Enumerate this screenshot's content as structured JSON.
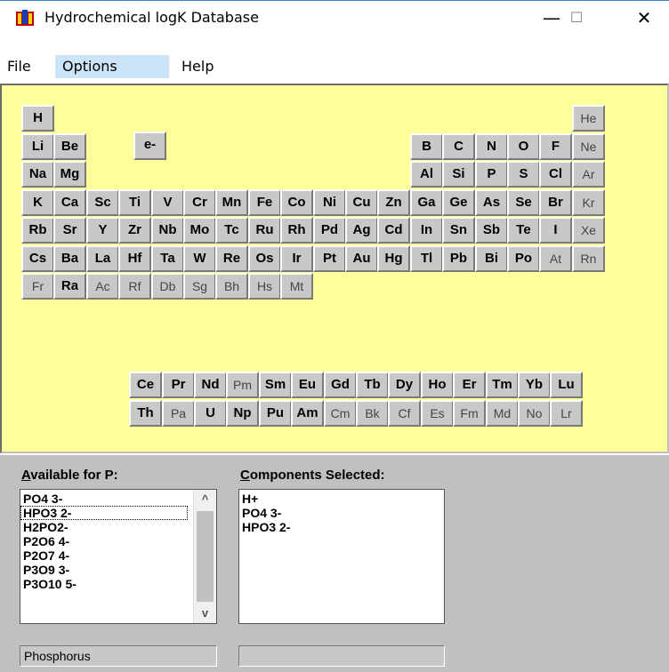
{
  "window": {
    "title": "Hydrochemical logK Database",
    "minimize": "—",
    "maximize": "☐",
    "close": "✕"
  },
  "menu": [
    "File",
    "Options",
    "Help"
  ],
  "electron_button": "e-",
  "table_rows": [
    [
      [
        "H",
        "b"
      ],
      null,
      null,
      null,
      null,
      null,
      null,
      null,
      null,
      null,
      null,
      null,
      null,
      null,
      null,
      null,
      null,
      [
        "He",
        "d"
      ]
    ],
    [
      [
        "Li",
        "b"
      ],
      [
        "Be",
        "b"
      ],
      null,
      null,
      null,
      null,
      null,
      null,
      null,
      null,
      null,
      null,
      [
        "B",
        "b"
      ],
      [
        "C",
        "b"
      ],
      [
        "N",
        "b"
      ],
      [
        "O",
        "b"
      ],
      [
        "F",
        "b"
      ],
      [
        "Ne",
        "d"
      ]
    ],
    [
      [
        "Na",
        "b"
      ],
      [
        "Mg",
        "b"
      ],
      null,
      null,
      null,
      null,
      null,
      null,
      null,
      null,
      null,
      null,
      [
        "Al",
        "b"
      ],
      [
        "Si",
        "b"
      ],
      [
        "P",
        "b"
      ],
      [
        "S",
        "b"
      ],
      [
        "Cl",
        "b"
      ],
      [
        "Ar",
        "d"
      ]
    ],
    [
      [
        "K",
        "b"
      ],
      [
        "Ca",
        "b"
      ],
      [
        "Sc",
        "b"
      ],
      [
        "Ti",
        "b"
      ],
      [
        "V",
        "b"
      ],
      [
        "Cr",
        "b"
      ],
      [
        "Mn",
        "b"
      ],
      [
        "Fe",
        "b"
      ],
      [
        "Co",
        "b"
      ],
      [
        "Ni",
        "b"
      ],
      [
        "Cu",
        "b"
      ],
      [
        "Zn",
        "b"
      ],
      [
        "Ga",
        "b"
      ],
      [
        "Ge",
        "b"
      ],
      [
        "As",
        "b"
      ],
      [
        "Se",
        "b"
      ],
      [
        "Br",
        "b"
      ],
      [
        "Kr",
        "d"
      ]
    ],
    [
      [
        "Rb",
        "b"
      ],
      [
        "Sr",
        "b"
      ],
      [
        "Y",
        "b"
      ],
      [
        "Zr",
        "b"
      ],
      [
        "Nb",
        "b"
      ],
      [
        "Mo",
        "b"
      ],
      [
        "Tc",
        "b"
      ],
      [
        "Ru",
        "b"
      ],
      [
        "Rh",
        "b"
      ],
      [
        "Pd",
        "b"
      ],
      [
        "Ag",
        "b"
      ],
      [
        "Cd",
        "b"
      ],
      [
        "In",
        "b"
      ],
      [
        "Sn",
        "b"
      ],
      [
        "Sb",
        "b"
      ],
      [
        "Te",
        "b"
      ],
      [
        "I",
        "b"
      ],
      [
        "Xe",
        "d"
      ]
    ],
    [
      [
        "Cs",
        "b"
      ],
      [
        "Ba",
        "b"
      ],
      [
        "La",
        "b"
      ],
      [
        "Hf",
        "b"
      ],
      [
        "Ta",
        "b"
      ],
      [
        "W",
        "b"
      ],
      [
        "Re",
        "b"
      ],
      [
        "Os",
        "b"
      ],
      [
        "Ir",
        "b"
      ],
      [
        "Pt",
        "b"
      ],
      [
        "Au",
        "b"
      ],
      [
        "Hg",
        "b"
      ],
      [
        "Tl",
        "b"
      ],
      [
        "Pb",
        "b"
      ],
      [
        "Bi",
        "b"
      ],
      [
        "Po",
        "b"
      ],
      [
        "At",
        "d"
      ],
      [
        "Rn",
        "d"
      ]
    ],
    [
      [
        "Fr",
        "d"
      ],
      [
        "Ra",
        "b"
      ],
      [
        "Ac",
        "d"
      ],
      [
        "Rf",
        "d"
      ],
      [
        "Db",
        "d"
      ],
      [
        "Sg",
        "d"
      ],
      [
        "Bh",
        "d"
      ],
      [
        "Hs",
        "d"
      ],
      [
        "Mt",
        "d"
      ]
    ]
  ],
  "lanthanides": [
    [
      "Ce",
      "b"
    ],
    [
      "Pr",
      "b"
    ],
    [
      "Nd",
      "b"
    ],
    [
      "Pm",
      "d"
    ],
    [
      "Sm",
      "b"
    ],
    [
      "Eu",
      "b"
    ],
    [
      "Gd",
      "b"
    ],
    [
      "Tb",
      "b"
    ],
    [
      "Dy",
      "b"
    ],
    [
      "Ho",
      "b"
    ],
    [
      "Er",
      "b"
    ],
    [
      "Tm",
      "b"
    ],
    [
      "Yb",
      "b"
    ],
    [
      "Lu",
      "b"
    ]
  ],
  "actinides": [
    [
      "Th",
      "b"
    ],
    [
      "Pa",
      "d"
    ],
    [
      "U",
      "b"
    ],
    [
      "Np",
      "b"
    ],
    [
      "Pu",
      "b"
    ],
    [
      "Am",
      "b"
    ],
    [
      "Cm",
      "d"
    ],
    [
      "Bk",
      "d"
    ],
    [
      "Cf",
      "d"
    ],
    [
      "Es",
      "d"
    ],
    [
      "Fm",
      "d"
    ],
    [
      "Md",
      "d"
    ],
    [
      "No",
      "d"
    ],
    [
      "Lr",
      "d"
    ]
  ],
  "available": {
    "label_first": "A",
    "label_rest": "vailable for P:",
    "items": [
      "PO4 3-",
      "HPO3 2-",
      "H2PO2-",
      "P2O6 4-",
      "P2O7 4-",
      "P3O9 3-",
      "P3O10 5-"
    ],
    "focused_index": 1,
    "scroll_up": "^",
    "scroll_down": "v"
  },
  "selected": {
    "label_first": "C",
    "label_rest": "omponents Selected:",
    "items": [
      "H+",
      "PO4 3-",
      "HPO3 2-"
    ]
  },
  "status": {
    "left": "Phosphorus",
    "right": ""
  },
  "colors": {
    "table_bg": "#ffff99",
    "panel_bg": "#c0c0c0",
    "button_face": "#c8c8c8"
  }
}
